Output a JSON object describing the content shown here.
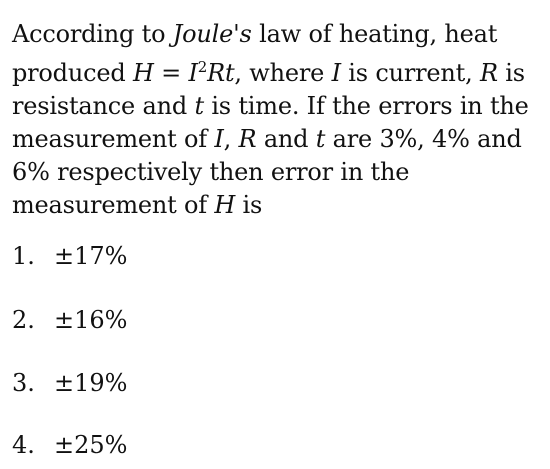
{
  "question": {
    "s1": "According to ",
    "joule": "Joule's",
    "s2": " law of heating, heat produced ",
    "formula_lhs": "H",
    "formula_eq": " = ",
    "formula_I": "I",
    "formula_exp": "2",
    "formula_Rt": "Rt",
    "s3": ", where ",
    "var_I": "I",
    "s4": " is current, ",
    "var_R": "R",
    "s5": " is resistance and ",
    "var_t": "t",
    "s6": " is time. If the errors in the measurement of ",
    "var_I2": "I",
    "s7": ", ",
    "var_R2": "R",
    "s8": " and ",
    "var_t2": "t",
    "s9": " are 3%, 4% and 6% respectively then error in the measurement of ",
    "var_H": "H",
    "s10": " is"
  },
  "options": [
    {
      "num": "1.",
      "value": "±17%"
    },
    {
      "num": "2.",
      "value": "±16%"
    },
    {
      "num": "3.",
      "value": "±19%"
    },
    {
      "num": "4.",
      "value": "±25%"
    }
  ]
}
